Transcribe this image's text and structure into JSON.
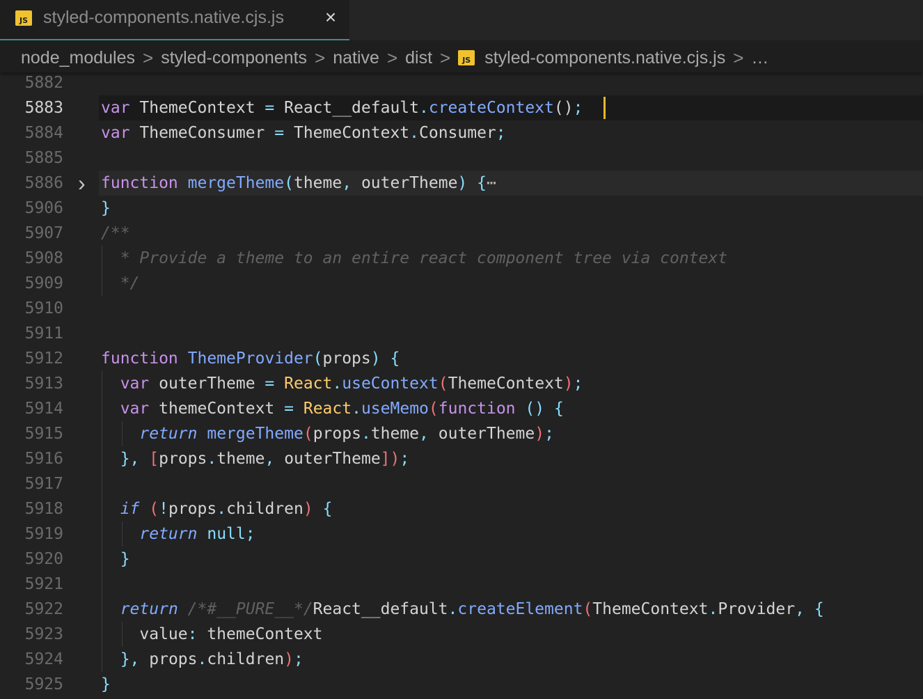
{
  "tab": {
    "icon": "javascript-file-icon",
    "badge": "JS",
    "title": "styled-components.native.cjs.js",
    "close": "×"
  },
  "breadcrumb": {
    "items": [
      "node_modules",
      "styled-components",
      "native",
      "dist"
    ],
    "file": "styled-components.native.cjs.js",
    "more": "…",
    "separator": ">"
  },
  "editor": {
    "active_line": "5883",
    "folded_line": "5886",
    "lines": [
      {
        "n": "5882",
        "tokens": []
      },
      {
        "n": "5883",
        "tokens": [
          [
            "kw",
            "var"
          ],
          [
            "pl",
            " ThemeContext "
          ],
          [
            "p",
            "="
          ],
          [
            "pl",
            " React__default"
          ],
          [
            "p",
            "."
          ],
          [
            "fn",
            "createContext"
          ],
          [
            "pl",
            "()"
          ],
          [
            "p",
            ";"
          ]
        ]
      },
      {
        "n": "5884",
        "tokens": [
          [
            "kw",
            "var"
          ],
          [
            "pl",
            " ThemeConsumer "
          ],
          [
            "p",
            "="
          ],
          [
            "pl",
            " ThemeContext"
          ],
          [
            "p",
            "."
          ],
          [
            "pl",
            "Consumer"
          ],
          [
            "p",
            ";"
          ]
        ]
      },
      {
        "n": "5885",
        "tokens": []
      },
      {
        "n": "5886",
        "tokens": [
          [
            "kw",
            "function"
          ],
          [
            "pl",
            " "
          ],
          [
            "fn",
            "mergeTheme"
          ],
          [
            "p",
            "("
          ],
          [
            "pl",
            "theme"
          ],
          [
            "p",
            ","
          ],
          [
            "pl",
            " outerTheme"
          ],
          [
            "p",
            ")"
          ],
          [
            "pl",
            " "
          ],
          [
            "p",
            "{"
          ],
          [
            "dots",
            "⋯"
          ]
        ]
      },
      {
        "n": "5906",
        "tokens": [
          [
            "p",
            "}"
          ]
        ]
      },
      {
        "n": "5907",
        "tokens": [
          [
            "cm",
            "/**"
          ]
        ]
      },
      {
        "n": "5908",
        "tokens": [
          [
            "cm",
            "  * Provide a theme to an entire react component tree via context"
          ]
        ]
      },
      {
        "n": "5909",
        "tokens": [
          [
            "cm",
            "  */"
          ]
        ]
      },
      {
        "n": "5910",
        "tokens": []
      },
      {
        "n": "5911",
        "tokens": []
      },
      {
        "n": "5912",
        "tokens": [
          [
            "kw",
            "function"
          ],
          [
            "pl",
            " "
          ],
          [
            "fn",
            "ThemeProvider"
          ],
          [
            "p",
            "("
          ],
          [
            "pl",
            "props"
          ],
          [
            "p",
            ")"
          ],
          [
            "pl",
            " "
          ],
          [
            "p",
            "{"
          ]
        ]
      },
      {
        "n": "5913",
        "tokens": [
          [
            "pl",
            "  "
          ],
          [
            "kw",
            "var"
          ],
          [
            "pl",
            " outerTheme "
          ],
          [
            "p",
            "="
          ],
          [
            "pl",
            " "
          ],
          [
            "obj",
            "React"
          ],
          [
            "p",
            "."
          ],
          [
            "fn",
            "useContext"
          ],
          [
            "br",
            "("
          ],
          [
            "pl",
            "ThemeContext"
          ],
          [
            "br",
            ")"
          ],
          [
            "p",
            ";"
          ]
        ]
      },
      {
        "n": "5914",
        "tokens": [
          [
            "pl",
            "  "
          ],
          [
            "kw",
            "var"
          ],
          [
            "pl",
            " themeContext "
          ],
          [
            "p",
            "="
          ],
          [
            "pl",
            " "
          ],
          [
            "obj",
            "React"
          ],
          [
            "p",
            "."
          ],
          [
            "fn",
            "useMemo"
          ],
          [
            "br",
            "("
          ],
          [
            "kw",
            "function"
          ],
          [
            "pl",
            " "
          ],
          [
            "p",
            "()"
          ],
          [
            "pl",
            " "
          ],
          [
            "p",
            "{"
          ]
        ]
      },
      {
        "n": "5915",
        "tokens": [
          [
            "pl",
            "    "
          ],
          [
            "ctl",
            "return"
          ],
          [
            "pl",
            " "
          ],
          [
            "fn",
            "mergeTheme"
          ],
          [
            "br",
            "("
          ],
          [
            "pl",
            "props"
          ],
          [
            "p",
            "."
          ],
          [
            "pl",
            "theme"
          ],
          [
            "p",
            ","
          ],
          [
            "pl",
            " outerTheme"
          ],
          [
            "br",
            ")"
          ],
          [
            "p",
            ";"
          ]
        ]
      },
      {
        "n": "5916",
        "tokens": [
          [
            "pl",
            "  "
          ],
          [
            "p",
            "},"
          ],
          [
            "pl",
            " "
          ],
          [
            "br",
            "["
          ],
          [
            "pl",
            "props"
          ],
          [
            "p",
            "."
          ],
          [
            "pl",
            "theme"
          ],
          [
            "p",
            ","
          ],
          [
            "pl",
            " outerTheme"
          ],
          [
            "br",
            "])"
          ],
          [
            "p",
            ";"
          ]
        ]
      },
      {
        "n": "5917",
        "tokens": []
      },
      {
        "n": "5918",
        "tokens": [
          [
            "pl",
            "  "
          ],
          [
            "ctl",
            "if"
          ],
          [
            "pl",
            " "
          ],
          [
            "br",
            "("
          ],
          [
            "p",
            "!"
          ],
          [
            "pl",
            "props"
          ],
          [
            "p",
            "."
          ],
          [
            "pl",
            "children"
          ],
          [
            "br",
            ")"
          ],
          [
            "pl",
            " "
          ],
          [
            "p",
            "{"
          ]
        ]
      },
      {
        "n": "5919",
        "tokens": [
          [
            "pl",
            "    "
          ],
          [
            "ctl",
            "return"
          ],
          [
            "pl",
            " "
          ],
          [
            "p",
            "null;"
          ]
        ]
      },
      {
        "n": "5920",
        "tokens": [
          [
            "pl",
            "  "
          ],
          [
            "p",
            "}"
          ]
        ]
      },
      {
        "n": "5921",
        "tokens": []
      },
      {
        "n": "5922",
        "tokens": [
          [
            "pl",
            "  "
          ],
          [
            "ctl",
            "return"
          ],
          [
            "pl",
            " "
          ],
          [
            "cm",
            "/*#__PURE__*/"
          ],
          [
            "pl",
            "React__default"
          ],
          [
            "p",
            "."
          ],
          [
            "fn",
            "createElement"
          ],
          [
            "br",
            "("
          ],
          [
            "pl",
            "ThemeContext"
          ],
          [
            "p",
            "."
          ],
          [
            "pl",
            "Provider"
          ],
          [
            "p",
            ","
          ],
          [
            "pl",
            " "
          ],
          [
            "p",
            "{"
          ]
        ]
      },
      {
        "n": "5923",
        "tokens": [
          [
            "pl",
            "    value"
          ],
          [
            "p",
            ":"
          ],
          [
            "pl",
            " themeContext"
          ]
        ]
      },
      {
        "n": "5924",
        "tokens": [
          [
            "pl",
            "  "
          ],
          [
            "p",
            "},"
          ],
          [
            "pl",
            " props"
          ],
          [
            "p",
            "."
          ],
          [
            "pl",
            "children"
          ],
          [
            "br",
            ")"
          ],
          [
            "p",
            ";"
          ]
        ]
      },
      {
        "n": "5925",
        "tokens": [
          [
            "p",
            "}"
          ]
        ]
      }
    ]
  },
  "colors": {
    "background": "#222222",
    "tab_accent": "#3f8d95",
    "js_badge": "#f0c22f",
    "cursor": "#e8b923"
  }
}
